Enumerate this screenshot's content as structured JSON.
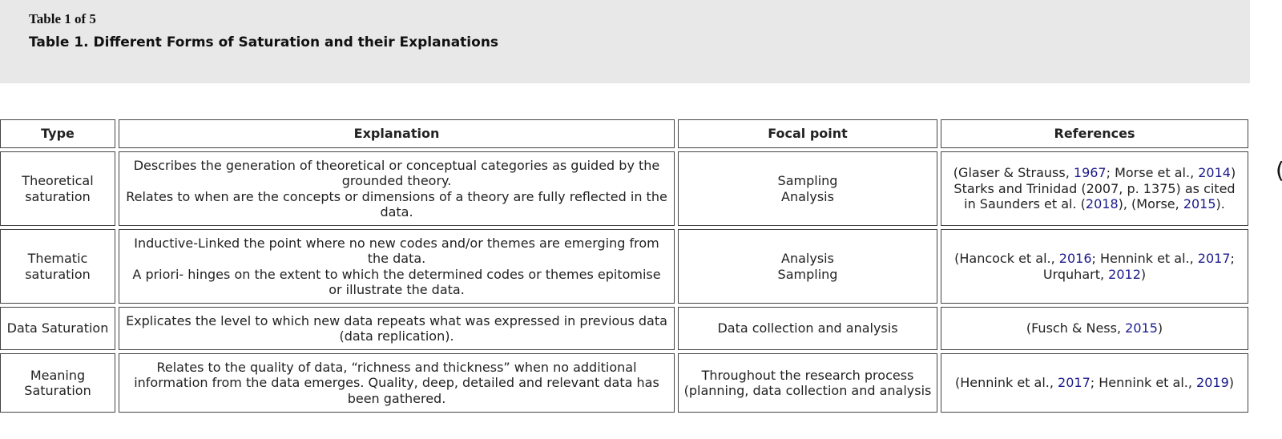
{
  "header": {
    "counter": "Table 1 of 5",
    "title": "Table 1. Different Forms of Saturation and their Explanations"
  },
  "table": {
    "columns": [
      "Type",
      "Explanation",
      "Focal point",
      "References"
    ],
    "rows": [
      {
        "type": [
          "Theoretical",
          "saturation"
        ],
        "explanation": [
          "Describes the generation of theoretical or conceptual categories as guided by the grounded theory.",
          "Relates to when are the concepts or dimensions of a theory are fully reflected in the data."
        ],
        "focal": [
          "Sampling",
          "Analysis"
        ],
        "refs": [
          {
            "t": "(Glaser & Strauss, "
          },
          {
            "t": "1967",
            "link": true
          },
          {
            "t": "; Morse et al., "
          },
          {
            "t": "2014",
            "link": true
          },
          {
            "t": ") Starks and Trinidad (2007, p. 1375) as cited in Saunders et al. ("
          },
          {
            "t": "2018",
            "link": true
          },
          {
            "t": "), (Morse, "
          },
          {
            "t": "2015",
            "link": true
          },
          {
            "t": ")."
          }
        ]
      },
      {
        "type": [
          "Thematic",
          "saturation"
        ],
        "explanation": [
          "Inductive-Linked the point where no new codes and/or themes are emerging from the data.",
          "A priori- hinges on the extent to which the determined codes or themes epitomise or illustrate the data."
        ],
        "focal": [
          "Analysis",
          "Sampling"
        ],
        "refs": [
          {
            "t": "(Hancock et al., "
          },
          {
            "t": "2016",
            "link": true
          },
          {
            "t": "; Hennink et al., "
          },
          {
            "t": "2017",
            "link": true
          },
          {
            "t": "; Urquhart, "
          },
          {
            "t": "2012",
            "link": true
          },
          {
            "t": ")"
          }
        ]
      },
      {
        "type": [
          "Data Saturation"
        ],
        "explanation": [
          "Explicates the level to which new data repeats what was expressed in previous data (data replication)."
        ],
        "focal": [
          "Data collection and analysis"
        ],
        "refs": [
          {
            "t": "(Fusch & Ness, "
          },
          {
            "t": "2015",
            "link": true
          },
          {
            "t": ")"
          }
        ]
      },
      {
        "type": [
          "Meaning",
          "Saturation"
        ],
        "explanation": [
          "Relates to the quality of data, “richness and thickness” when no additional information from the data emerges. Quality, deep, detailed and relevant data has been gathered."
        ],
        "focal": [
          "Throughout the research process",
          "(planning, data collection and analysis"
        ],
        "refs": [
          {
            "t": "(Hennink et al., "
          },
          {
            "t": "2017",
            "link": true
          },
          {
            "t": "; Hennink et al., "
          },
          {
            "t": "2019",
            "link": true
          },
          {
            "t": ")"
          }
        ]
      }
    ]
  },
  "colors": {
    "header_bg": "#e8e8e8",
    "link": "#1a1a8c",
    "border": "#444444"
  },
  "edge_glyph": "("
}
